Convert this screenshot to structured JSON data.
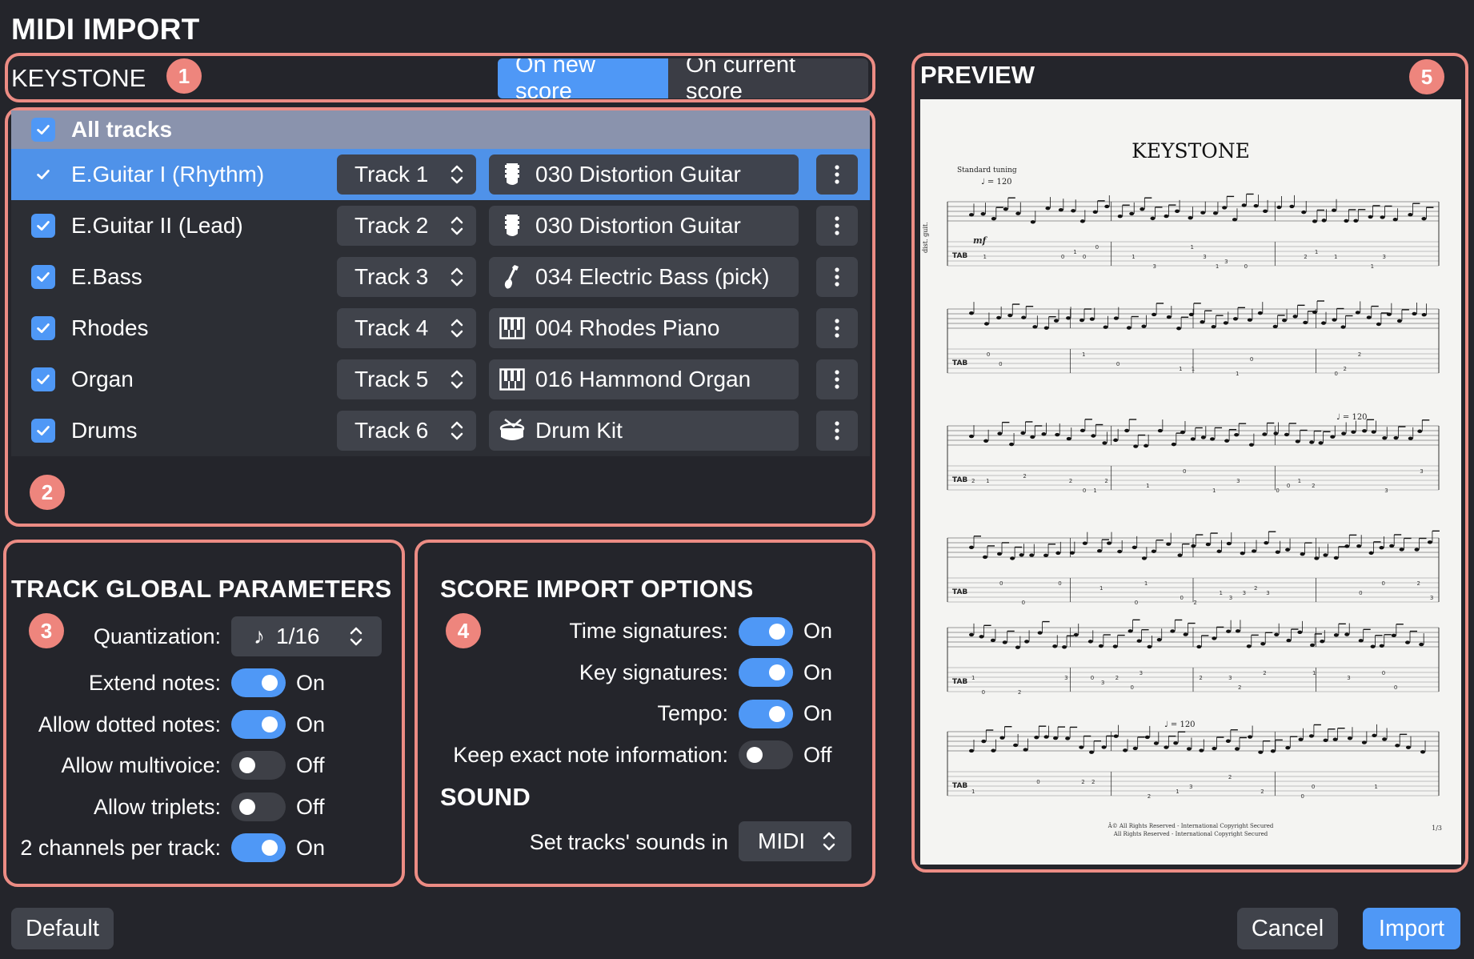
{
  "window": {
    "title": "MIDI IMPORT"
  },
  "header": {
    "file_name": "KEYSTONE",
    "import_mode": {
      "options": [
        "On new score",
        "On current score"
      ],
      "selected": "On new score"
    }
  },
  "annotations": [
    "1",
    "2",
    "3",
    "4",
    "5"
  ],
  "tracks": {
    "all_label": "All tracks",
    "all_checked": true,
    "rows": [
      {
        "name": "E.Guitar I (Rhythm)",
        "checked": true,
        "track": "Track 1",
        "instrument": "030 Distortion Guitar",
        "icon": "guitar-icon",
        "selected": true
      },
      {
        "name": "E.Guitar II (Lead)",
        "checked": true,
        "track": "Track 2",
        "instrument": "030 Distortion Guitar",
        "icon": "guitar-icon",
        "selected": false
      },
      {
        "name": "E.Bass",
        "checked": true,
        "track": "Track 3",
        "instrument": "034 Electric Bass (pick)",
        "icon": "bass-icon",
        "selected": false
      },
      {
        "name": "Rhodes",
        "checked": true,
        "track": "Track 4",
        "instrument": "004 Rhodes Piano",
        "icon": "piano-icon",
        "selected": false
      },
      {
        "name": "Organ",
        "checked": true,
        "track": "Track 5",
        "instrument": "016 Hammond Organ",
        "icon": "piano-icon",
        "selected": false
      },
      {
        "name": "Drums",
        "checked": true,
        "track": "Track 6",
        "instrument": "Drum Kit",
        "icon": "drum-icon",
        "selected": false
      }
    ]
  },
  "track_global": {
    "title": "TRACK GLOBAL PARAMETERS",
    "quantization_label": "Quantization:",
    "quantization_value": "1/16",
    "params": [
      {
        "label": "Extend notes:",
        "on": true,
        "text": "On"
      },
      {
        "label": "Allow dotted notes:",
        "on": true,
        "text": "On"
      },
      {
        "label": "Allow multivoice:",
        "on": false,
        "text": "Off"
      },
      {
        "label": "Allow triplets:",
        "on": false,
        "text": "Off"
      },
      {
        "label": "2 channels per track:",
        "on": true,
        "text": "On"
      }
    ]
  },
  "score_import": {
    "title": "SCORE IMPORT OPTIONS",
    "options": [
      {
        "label": "Time signatures:",
        "on": true,
        "text": "On"
      },
      {
        "label": "Key signatures:",
        "on": true,
        "text": "On"
      },
      {
        "label": "Tempo:",
        "on": true,
        "text": "On"
      },
      {
        "label": "Keep exact note information:",
        "on": false,
        "text": "Off"
      }
    ],
    "sound_title": "SOUND",
    "sound_label": "Set tracks' sounds in",
    "sound_value": "MIDI"
  },
  "preview": {
    "title": "PREVIEW",
    "score_title": "KEYSTONE",
    "tuning": "Standard tuning",
    "tempo_marks": [
      "♩ = 120",
      "♩ = 120",
      "♩ = 120"
    ],
    "dynamic": "mf",
    "instrument_abbr": "dist. guit.",
    "copyright_line1": "Â© All Rights Reserved - International Copyright Secured",
    "copyright_line2": "All Rights Reserved - International Copyright Secured",
    "page_number": "1/3"
  },
  "footer": {
    "default_label": "Default",
    "cancel_label": "Cancel",
    "import_label": "Import"
  },
  "colors": {
    "accent": "#4f98f6",
    "annotation": "#ee857d",
    "background": "#24252b"
  }
}
